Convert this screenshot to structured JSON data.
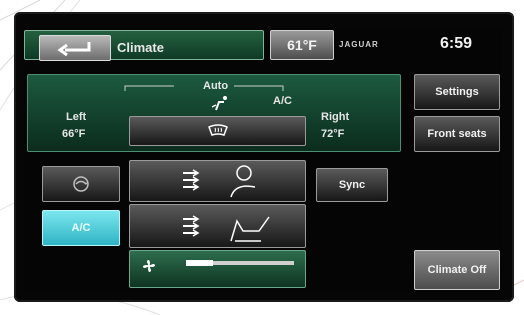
{
  "header": {
    "back_icon": "back-arrow-icon",
    "title": "Climate",
    "outside_temp": "61°F",
    "brand": "JAGUAR",
    "clock": "6:59"
  },
  "climate": {
    "auto_label": "Auto",
    "airflow_icon": "airflow-person-icon",
    "ac_label": "A/C",
    "left_label": "Left",
    "left_temp": "66°F",
    "right_label": "Right",
    "right_temp": "72°F",
    "defrost_icon": "front-defrost-icon"
  },
  "buttons": {
    "settings": "Settings",
    "front_seats": "Front seats",
    "sync": "Sync",
    "ac": "A/C",
    "climate_off": "Climate Off"
  },
  "vent": {
    "recirc_icon": "recirculation-icon",
    "face_icon": "face-vent-icon",
    "seat_icon": "seat-vent-icon"
  },
  "fan": {
    "icon": "fan-icon",
    "level_fraction": 0.25
  },
  "colors": {
    "accent_green": "#1c5a3e",
    "accent_cyan": "#4fd0dc"
  }
}
